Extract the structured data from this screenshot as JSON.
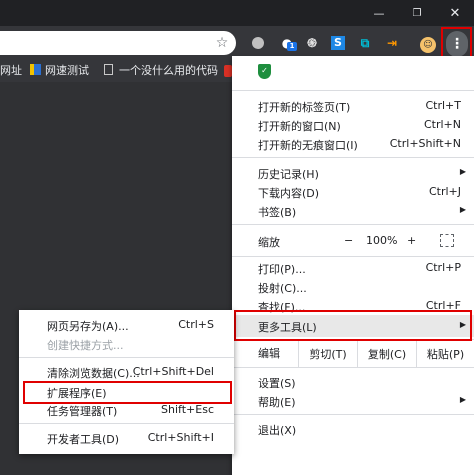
{
  "window": {
    "min_icon": "—",
    "max_icon": "❐",
    "close_icon": "✕"
  },
  "toolbar": {
    "star_icon": "☆",
    "ext2_badge": "1",
    "ext4_label": "S",
    "menu_icon": "⋮"
  },
  "bookmarks": [
    {
      "label": "网址"
    },
    {
      "label": "网速测试"
    },
    {
      "label": "一个没什么用的代码"
    }
  ],
  "menu": {
    "new_tab": {
      "label": "打开新的标签页(T)",
      "shortcut": "Ctrl+T"
    },
    "new_window": {
      "label": "打开新的窗口(N)",
      "shortcut": "Ctrl+N"
    },
    "incognito": {
      "label": "打开新的无痕窗口(I)",
      "shortcut": "Ctrl+Shift+N"
    },
    "history": {
      "label": "历史记录(H)"
    },
    "downloads": {
      "label": "下载内容(D)",
      "shortcut": "Ctrl+J"
    },
    "bookmarks": {
      "label": "书签(B)"
    },
    "zoom": {
      "label": "缩放",
      "minus": "−",
      "value": "100%",
      "plus": "+"
    },
    "print": {
      "label": "打印(P)...",
      "shortcut": "Ctrl+P"
    },
    "cast": {
      "label": "投射(C)..."
    },
    "find": {
      "label": "查找(F)...",
      "shortcut": "Ctrl+F"
    },
    "more_tools": {
      "label": "更多工具(L)"
    },
    "edit": {
      "label": "编辑",
      "cut": "剪切(T)",
      "copy": "复制(C)",
      "paste": "粘贴(P)"
    },
    "settings": {
      "label": "设置(S)"
    },
    "help": {
      "label": "帮助(E)"
    },
    "exit": {
      "label": "退出(X)"
    }
  },
  "submenu": {
    "save_page": {
      "label": "网页另存为(A)...",
      "shortcut": "Ctrl+S"
    },
    "create_shortcut": {
      "label": "创建快捷方式..."
    },
    "clear_data": {
      "label": "清除浏览数据(C)...",
      "shortcut": "Ctrl+Shift+Del"
    },
    "extensions": {
      "label": "扩展程序(E)"
    },
    "task_manager": {
      "label": "任务管理器(T)",
      "shortcut": "Shift+Esc"
    },
    "dev_tools": {
      "label": "开发者工具(D)",
      "shortcut": "Ctrl+Shift+I"
    }
  },
  "colors": {
    "highlight": "#e00000",
    "titlebar": "#202124",
    "toolbar": "#35363a"
  }
}
